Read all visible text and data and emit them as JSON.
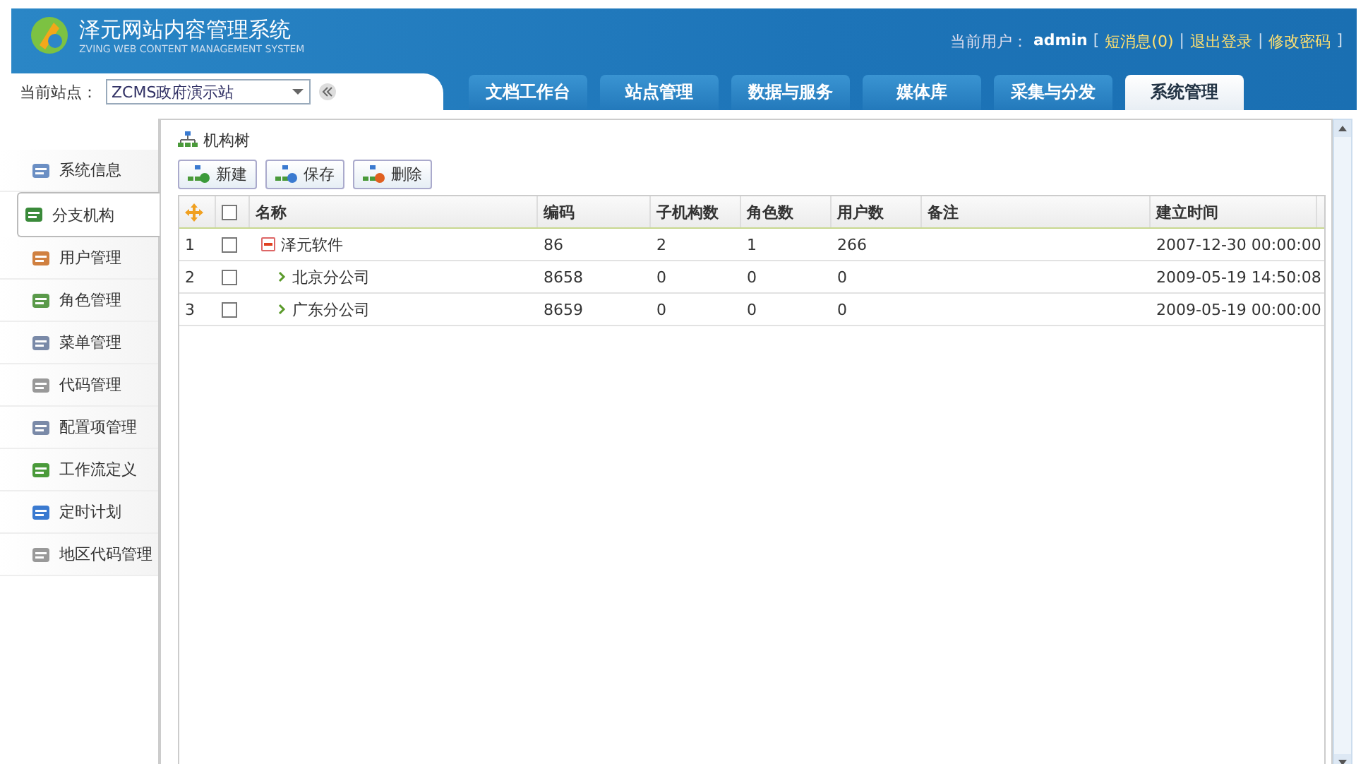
{
  "header": {
    "title": "泽元网站内容管理系统",
    "subtitle": "ZVING WEB CONTENT MANAGEMENT SYSTEM",
    "user_label": "当前用户：",
    "user": "admin",
    "bracket_open": "[",
    "links": [
      "短消息(0)",
      "退出登录",
      "修改密码"
    ],
    "separators": [
      "|",
      "|"
    ],
    "bracket_close": "]"
  },
  "site": {
    "label": "当前站点：",
    "value": "ZCMS政府演示站"
  },
  "tabs": [
    {
      "label": "文档工作台",
      "selected": false
    },
    {
      "label": "站点管理",
      "selected": false
    },
    {
      "label": "数据与服务",
      "selected": false
    },
    {
      "label": "媒体库",
      "selected": false
    },
    {
      "label": "采集与分发",
      "selected": false
    },
    {
      "label": "系统管理",
      "selected": true
    }
  ],
  "sidebar": {
    "items": [
      {
        "label": "系统信息",
        "selected": false
      },
      {
        "label": "分支机构",
        "selected": true
      },
      {
        "label": "用户管理",
        "selected": false
      },
      {
        "label": "角色管理",
        "selected": false
      },
      {
        "label": "菜单管理",
        "selected": false
      },
      {
        "label": "代码管理",
        "selected": false
      },
      {
        "label": "配置项管理",
        "selected": false
      },
      {
        "label": "工作流定义",
        "selected": false
      },
      {
        "label": "定时计划",
        "selected": false
      },
      {
        "label": "地区代码管理",
        "selected": false
      }
    ]
  },
  "panel": {
    "title": "机构树",
    "buttons": [
      "新建",
      "保存",
      "删除"
    ]
  },
  "table": {
    "all_checked": false,
    "columns": [
      "名称",
      "编码",
      "子机构数",
      "角色数",
      "用户数",
      "备注",
      "建立时间"
    ],
    "rows": [
      {
        "index": "1",
        "checked": false,
        "expanded": true,
        "name": "泽元软件",
        "code": "86",
        "sub": "2",
        "roles": "1",
        "users": "266",
        "created": "2007-12-30 00:00:00",
        "children": [
          {
            "index": "2",
            "checked": false,
            "name": "北京分公司",
            "code": "8658",
            "sub": "0",
            "roles": "0",
            "users": "0",
            "created": "2009-05-19 14:50:08"
          },
          {
            "index": "3",
            "checked": false,
            "name": "广东分公司",
            "code": "8659",
            "sub": "0",
            "roles": "0",
            "users": "0",
            "created": "2009-05-19 00:00:00"
          }
        ]
      }
    ]
  }
}
